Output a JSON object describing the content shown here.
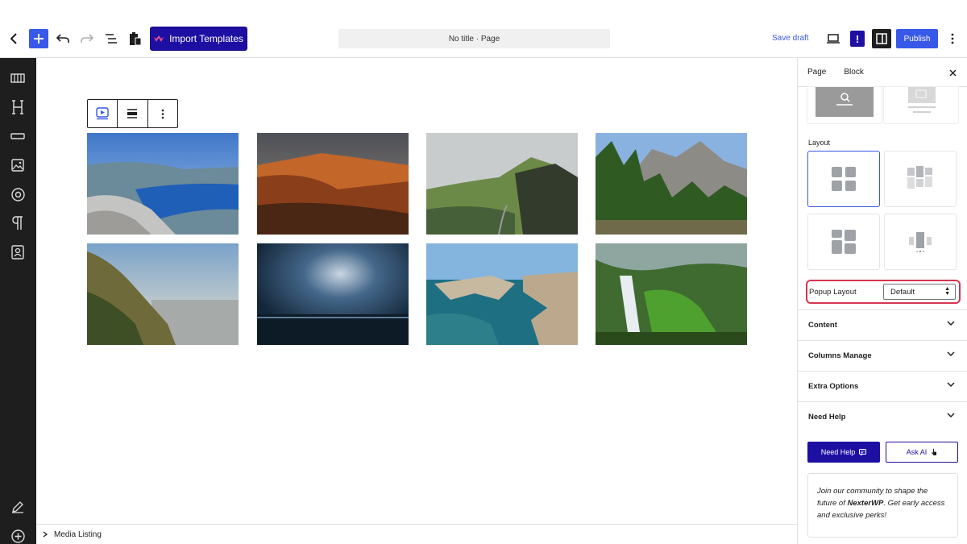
{
  "toolbar": {
    "import_label": "Import Templates",
    "doc_title": "No title · Page",
    "save_draft_label": "Save draft",
    "publish_label": "Publish",
    "excl_label": "!"
  },
  "breadcrumb": {
    "label": "Media Listing"
  },
  "sidebar": {
    "tabs": [
      "Page",
      "Block"
    ],
    "layout_label": "Layout",
    "popup_layout_label": "Popup Layout",
    "popup_layout_value": "Default",
    "sections": [
      "Content",
      "Columns Manage",
      "Extra Options",
      "Need Help"
    ],
    "need_help_button": "Need Help",
    "ask_ai_button": "Ask AI",
    "community_pre": "Join our community to shape the future of ",
    "community_brand": "NexterWP",
    "community_post": ". Get early access and exclusive perks!"
  },
  "gallery": [
    {
      "name": "fjord-cliff",
      "sky": "#6f9ed6",
      "mid": "#2a63b4",
      "ground": "#b8b9bd"
    },
    {
      "name": "red-canyon",
      "sky": "#6c6f7a",
      "mid": "#b25a24",
      "ground": "#5a2e18"
    },
    {
      "name": "green-ridge",
      "sky": "#c9cccd",
      "mid": "#5d7a3c",
      "ground": "#2f3b26"
    },
    {
      "name": "yosemite-valley",
      "sky": "#8ab2e0",
      "mid": "#8d8b86",
      "ground": "#2c4a1f"
    },
    {
      "name": "coastal-cliffs",
      "sky": "#b7c7d6",
      "mid": "#a48f67",
      "ground": "#4a5a2c"
    },
    {
      "name": "storm-sea",
      "sky": "#34536f",
      "mid": "#1c3349",
      "ground": "#0c1a24"
    },
    {
      "name": "sea-arches",
      "sky": "#84b5df",
      "mid": "#1f6f83",
      "ground": "#c3b39a"
    },
    {
      "name": "forest-waterfall",
      "sky": "#4e7a3a",
      "mid": "#e7edf0",
      "ground": "#2f5a1f"
    }
  ],
  "colors": {
    "accent": "#3858e9",
    "brand": "#1e0fa3",
    "highlight": "#d63550",
    "rail": "#1e1e1e"
  }
}
